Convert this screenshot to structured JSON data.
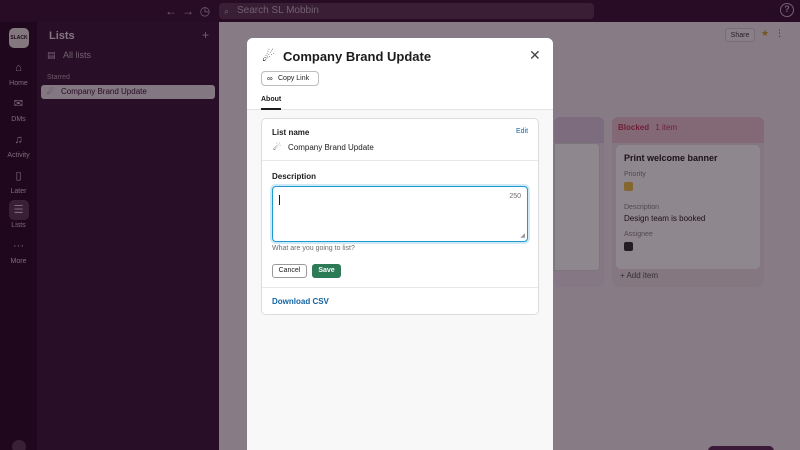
{
  "topbar": {
    "search_placeholder": "Search SL Mobbin"
  },
  "rail": {
    "workspace_logo": "SLACK",
    "items": [
      {
        "label": "Home",
        "icon": "home-icon"
      },
      {
        "label": "DMs",
        "icon": "dms-icon"
      },
      {
        "label": "Activity",
        "icon": "bell-icon"
      },
      {
        "label": "Later",
        "icon": "bookmark-icon"
      },
      {
        "label": "Lists",
        "icon": "lists-icon"
      },
      {
        "label": "More",
        "icon": "ellipsis-icon"
      }
    ],
    "active": "Lists"
  },
  "sidebar": {
    "title": "Lists",
    "all_lists": "All lists",
    "section": "Starred",
    "starred_item": "Company Brand Update"
  },
  "main": {
    "share": "Share",
    "blocked_column": {
      "title": "Blocked",
      "count": "1 item",
      "card_title": "Print welcome banner",
      "priority_label": "Priority",
      "description_label": "Description",
      "description_value": "Design team is booked",
      "assignee_label": "Assignee",
      "add_item": "Add item"
    }
  },
  "modal": {
    "title": "Company Brand Update",
    "copy_link": "Copy Link",
    "tab_about": "About",
    "list_name_label": "List name",
    "edit": "Edit",
    "list_name_value": "Company Brand Update",
    "description_label": "Description",
    "char_count": "250",
    "hint": "What are you going to list?",
    "cancel": "Cancel",
    "save": "Save",
    "download_csv": "Download CSV"
  },
  "colors": {
    "accent_green": "#2d7a57",
    "link_blue": "#1264a3",
    "focus_blue": "#1d9bd1",
    "aubergine": "#3a1336"
  }
}
